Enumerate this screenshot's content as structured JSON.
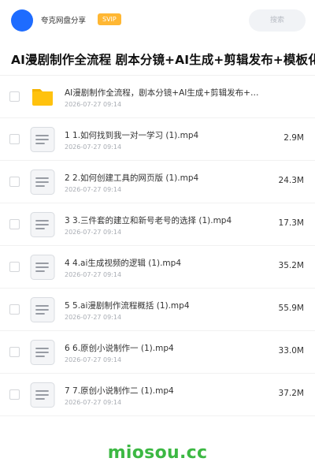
{
  "header": {
    "app_name": "夸克网盘分享",
    "badge": "SVIP",
    "search_placeholder": "搜索"
  },
  "folder_title": "AI漫剧制作全流程 剧本分镜+AI生成+剪辑发布+模板化量产",
  "files": [
    {
      "type": "folder",
      "name": "AI漫剧制作全流程，剧本分镜+AI生成+剪辑发布+…",
      "date": "2026-07-27 09:14",
      "size": ""
    },
    {
      "type": "video",
      "name": "1 1.如何找到我一对一学习 (1).mp4",
      "date": "2026-07-27 09:14",
      "size": "2.9M"
    },
    {
      "type": "video",
      "name": "2 2.如何创建工具的网页版 (1).mp4",
      "date": "2026-07-27 09:14",
      "size": "24.3M"
    },
    {
      "type": "video",
      "name": "3 3.三件套的建立和新号老号的选择 (1).mp4",
      "date": "2026-07-27 09:14",
      "size": "17.3M"
    },
    {
      "type": "video",
      "name": "4 4.ai生成视频的逻辑 (1).mp4",
      "date": "2026-07-27 09:14",
      "size": "35.2M"
    },
    {
      "type": "video",
      "name": "5 5.ai漫剧制作流程概括 (1).mp4",
      "date": "2026-07-27 09:14",
      "size": "55.9M"
    },
    {
      "type": "video",
      "name": "6 6.原创小说制作一 (1).mp4",
      "date": "2026-07-27 09:14",
      "size": "33.0M"
    },
    {
      "type": "video",
      "name": "7 7.原创小说制作二 (1).mp4",
      "date": "2026-07-27 09:14",
      "size": "37.2M"
    }
  ],
  "watermark": "miosou.cc",
  "colors": {
    "avatar": "#1e6cff",
    "svip_badge": "#ffb733",
    "folder": "#ffc20e",
    "watermark": "#3cb843"
  }
}
